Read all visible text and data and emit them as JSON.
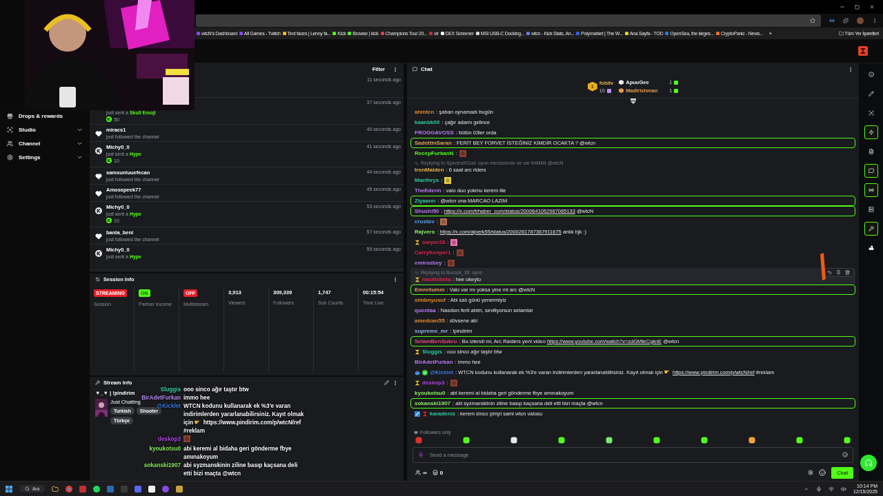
{
  "browser": {
    "bookmarks": [
      {
        "label": "wtcN's Dashboard"
      },
      {
        "label": "All Games - Twitch"
      },
      {
        "label": "Text faces | Lenny fa..."
      },
      {
        "label": "Kick"
      },
      {
        "label": "Browse | kick"
      },
      {
        "label": "Champions Tour 20..."
      },
      {
        "label": "vlr"
      },
      {
        "label": "DEX Screener"
      },
      {
        "label": "MSI USB-C Docking..."
      },
      {
        "label": "wtcn - Kick Stats, An..."
      },
      {
        "label": "Polymarket | The W..."
      },
      {
        "label": "Ana Sayfa - TOD"
      },
      {
        "label": "OpenSea, the larges..."
      },
      {
        "label": "CryptoPanic - News..."
      }
    ],
    "more": "»",
    "all_bookmarks": "Tüm Yer İşaretleri"
  },
  "sidebar": {
    "items": [
      {
        "label": "Drops & rewards",
        "kind": "link"
      },
      {
        "label": "Studio",
        "kind": "group",
        "expanded": false
      },
      {
        "label": "Channel",
        "kind": "group",
        "expanded": false
      },
      {
        "label": "Settings",
        "kind": "group",
        "expanded": false
      }
    ]
  },
  "activity": {
    "filter": "Filter",
    "events": [
      {
        "kind": "hidden",
        "time": "11 seconds ago"
      },
      {
        "kind": "kick",
        "action": "just sent a",
        "gift": "Skull Emoji",
        "amount": "50",
        "time": "37 seconds ago"
      },
      {
        "kind": "follow",
        "user": "miracs1",
        "action": "just followed the channel",
        "time": "40 seconds ago"
      },
      {
        "kind": "kick",
        "user": "Michy0_0",
        "action": "just sent a",
        "gift": "Hype",
        "amount": "10",
        "time": "41 seconds ago"
      },
      {
        "kind": "follow",
        "user": "samsunluuefecan",
        "action": "just followed the channel",
        "time": "44 seconds ago"
      },
      {
        "kind": "follow",
        "user": "Amosspeek77",
        "action": "just followed the channel",
        "time": "45 seconds ago"
      },
      {
        "kind": "kick",
        "user": "Michy0_0",
        "action": "just sent a",
        "gift": "Hype",
        "amount": "10",
        "time": "53 seconds ago"
      },
      {
        "kind": "follow",
        "user": "banla_beni",
        "action": "just followed the channel",
        "time": "57 seconds ago"
      },
      {
        "kind": "kick",
        "user": "Michy0_0",
        "action": "just sent a",
        "gift": "Hype",
        "time": "59 seconds ago"
      }
    ]
  },
  "session": {
    "title": "Session Info",
    "stats": [
      {
        "kind": "status",
        "value": "STREAMING",
        "color": "#e5202d",
        "label": "Session"
      },
      {
        "kind": "status",
        "value": "ON",
        "color": "#53fc18",
        "label": "Partner Income"
      },
      {
        "kind": "status",
        "value": "OFF",
        "color": "#e5202d",
        "label": "Multistream"
      },
      {
        "kind": "count",
        "value": "3,913",
        "label": "Viewers"
      },
      {
        "kind": "count",
        "value": "309,339",
        "label": "Followers"
      },
      {
        "kind": "count",
        "value": "1,747",
        "label": "Sub Counts"
      },
      {
        "kind": "count",
        "value": "00:15:54",
        "label": "Time Live"
      }
    ]
  },
  "stream_info": {
    "title": "Stream Info",
    "stream_title": "▼_▼ | !pindirim",
    "category": "Just Chatting",
    "tags": [
      "Turkish",
      "Shooter",
      "Türkçe"
    ]
  },
  "overlay_chat": [
    {
      "user": "Sluggis",
      "color": "#3fd6a6",
      "text": "ooo sinco ağır taştır btw"
    },
    {
      "user": "BirAdetFurkan",
      "color": "#b98ef0",
      "text": "immo hee"
    },
    {
      "user": "@Kicklet",
      "color": "#3a7ae0",
      "text": "WTCN kodunu kullanarak ek %3'e varan indirimlerden yararlanabilirsiniz. Kayıt olmak için",
      "pointer": true,
      "link": "https://www.pindirim.com/p/wtcN/ref",
      "after": "#reklam"
    },
    {
      "user": "deskop3",
      "color": "#b04ae8",
      "emote": {
        "color": "#8a4030"
      }
    },
    {
      "user": "kyoukotsu0",
      "color": "#8ef060",
      "text": "abi keremi al bidaha geri gönderme fbye amınakoyum"
    },
    {
      "user": "sokanski1907",
      "color": "#8ef060",
      "text": "abi syzmanskinin ziline basıp kaçsana deli etti bizi maçta @wtcn"
    }
  ],
  "chat": {
    "title": "Chat",
    "gifters": [
      {
        "kind": "top",
        "rank": "1",
        "user": "fobitv",
        "count": "10",
        "color": "#e8b04a"
      },
      {
        "kind": "runner",
        "user": "ApuuGee",
        "count": "1",
        "color": "#f2f2f2"
      },
      {
        "kind": "runner",
        "user": "Madlrishman",
        "count": "1",
        "color": "#e89a4a"
      }
    ],
    "messages": [
      {
        "user": "ahmtcn",
        "color": "#e08a2e",
        "text": ": şaban oynamadı bugün",
        "highlighted": false,
        "hovered": false
      },
      {
        "user": "kaanbk00",
        "color": "#2ec9a0",
        "text": ": çağır adamı gelince",
        "highlighted": false,
        "hovered": false
      },
      {
        "user": "FROGGAVOSS",
        "color": "#b67cf0",
        "text": ": bütün 03ler orda",
        "highlighted": false,
        "hovered": false
      },
      {
        "user": "SadettinSaran",
        "color": "#e0a05a",
        "text": ": FERİT BEY FORVET İSTEĞİNİZ KİMDİR OCAKTA ? @wtcn",
        "highlighted": true,
        "hovered": false
      },
      {
        "user": "RecepFurkanN",
        "color": "#53fc18",
        "text": ":",
        "emote": {
          "color": "#8a4030"
        },
        "highlighted": false,
        "hovered": false
      },
      {
        "reply": "Replying to SpectraXGod: oyun menüsünde ne var firiiiiiiiiit @wtcN",
        "user": "IronMaiden",
        "color": "#e8b04a",
        "text": ": 6 saat arc riders",
        "highlighted": false,
        "hovered": false
      },
      {
        "user": "Maethrys",
        "color": "#2ec9a0",
        "text": ":",
        "emote": {
          "color": "#e8d040"
        },
        "highlighted": false,
        "hovered": false
      },
      {
        "user": "TheEdenn",
        "color": "#b67cf0",
        "text": ": valo duo yokmu kerem ille",
        "highlighted": false,
        "hovered": false
      },
      {
        "user": "Ziyaann",
        "color": "#2ec9a0",
        "text": ": @wtcn ona MARCAO LAZIM",
        "highlighted": true,
        "hovered": false
      },
      {
        "user": "Shushi50",
        "color": "#b67cf0",
        "text": ":",
        "link": "https://x.com/trhaber_com/status/2000641052987085133",
        "after": "@wtcN",
        "highlighted": true,
        "hovered": false
      },
      {
        "user": "crustov",
        "color": "#5aa0e8",
        "text": ":",
        "emote": {
          "color": "#b07050"
        },
        "highlighted": false,
        "hovered": false
      },
      {
        "user": "Rajvero",
        "color": "#8ef060",
        "text": ":",
        "link": "https://x.com/alperk55/status/2000261787367911675",
        "after": "anlık bjk :)",
        "highlighted": false,
        "hovered": false
      },
      {
        "badges": [
          {
            "kind": "sub"
          }
        ],
        "user": "sarper28",
        "color": "#e0204a",
        "text": ":",
        "emote": {
          "color": "#f070b0"
        },
        "highlighted": false,
        "hovered": false
      },
      {
        "user": "CarryKeeper1",
        "color": "#e0204a",
        "text": ":",
        "emote": {
          "color": "#8a4030"
        },
        "highlighted": false,
        "hovered": false
      },
      {
        "user": "emirozbey",
        "color": "#b67cf0",
        "text": ":",
        "emote": {
          "color": "#8a4030"
        },
        "highlighted": false,
        "hovered": false
      },
      {
        "reply": "Replying to Burock_35: aynn",
        "badges": [
          {
            "kind": "sub"
          }
        ],
        "user": "nasilisbeta",
        "color": "#e0204a",
        "text": ": hee okeyto",
        "highlighted": false,
        "hovered": true
      },
      {
        "user": "Emreilumm",
        "color": "#e0a05a",
        "text": ": Valo var mı yoksa yine mi arc @wtcN",
        "highlighted": true,
        "hovered": false
      },
      {
        "user": "simbnyusuf",
        "color": "#e08a2e",
        "text": ": Abi salı günü yenermiyiz",
        "highlighted": false,
        "hovered": false
      },
      {
        "user": "quentaa",
        "color": "#b67cf0",
        "text": ": Nasılsın ferit abim, seviliyorsun selamlar",
        "highlighted": false,
        "hovered": false
      },
      {
        "user": "amedcan55",
        "color": "#e08a2e",
        "text": ": dövsene abi",
        "highlighted": false,
        "hovered": false
      },
      {
        "user": "supreme_mr",
        "color": "#8fb0e8",
        "text": ": !pindirim",
        "highlighted": false,
        "hovered": false
      },
      {
        "user": "SelamBenSukru",
        "color": "#e04a7a",
        "text": ": Bu izlendi mi, Arc Raiders yeni video",
        "link": "https://www.youtube.com/watch?v=zdGMteCgknE",
        "after": "@wtcn",
        "highlighted": true,
        "hovered": false
      },
      {
        "badges": [
          {
            "kind": "sub"
          }
        ],
        "user": "Sluggis",
        "color": "#2ec9a0",
        "text": ": ooo sinco ağır taştır btw",
        "highlighted": false,
        "hovered": false
      },
      {
        "user": "BirAdetFurkan",
        "color": "#b67cf0",
        "text": ": immo hee",
        "highlighted": false,
        "hovered": false
      },
      {
        "badges": [
          {
            "kind": "bot"
          },
          {
            "kind": "verified"
          }
        ],
        "user": "@Kicklet",
        "color": "#3a7ae0",
        "text": ": WTCN kodunu kullanarak ek %3'e varan indirimlerden yararlanabilirsiniz. Kayıt olmak için",
        "pointer": true,
        "link": "https://www.pindirim.com/p/wtcN/ref",
        "after": "#reklam",
        "highlighted": false,
        "hovered": false
      },
      {
        "badges": [
          {
            "kind": "sub"
          }
        ],
        "user": "deskop3",
        "color": "#b040e0",
        "text": ":",
        "emote": {
          "color": "#8a4030"
        },
        "highlighted": false,
        "hovered": false
      },
      {
        "user": "kyoukotsu0",
        "color": "#8ef060",
        "text": ": abi keremi al bidaha geri gönderme fbye amınakoyum",
        "highlighted": false,
        "hovered": false
      },
      {
        "user": "sokanski1907",
        "color": "#8ef060",
        "text": ": abi syzmanskinin ziline basıp kaçsana deli etti bizi maçta @wtcn",
        "highlighted": true,
        "hovered": false
      },
      {
        "badges": [
          {
            "kind": "mod"
          },
          {
            "kind": "founder"
          }
        ],
        "user": "karadeniz",
        "color": "#2ec9a0",
        "text": ": kerem sinco çimpi sami wtcn valosu",
        "highlighted": false,
        "hovered": false
      }
    ],
    "mode": "Followers only",
    "placeholder": "Send a message",
    "points": "∞",
    "shop_count": "0",
    "send": "Chat"
  },
  "rail": [
    {
      "selected": false
    },
    {
      "selected": false
    },
    {
      "selected": false
    },
    {
      "selected": true
    },
    {
      "selected": false
    },
    {
      "selected": true
    },
    {
      "selected": true
    },
    {
      "selected": false
    },
    {
      "selected": true
    },
    {
      "selected": false
    }
  ],
  "taskbar": {
    "search": "Ara",
    "time": "10:14 PM",
    "date": "12/15/2025"
  }
}
